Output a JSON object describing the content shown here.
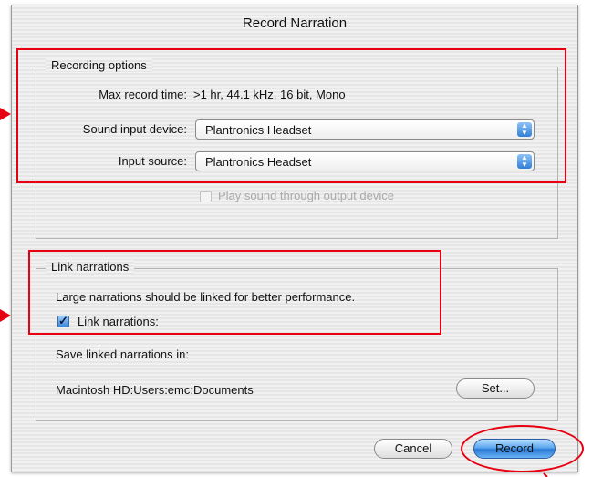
{
  "window": {
    "title": "Record Narration"
  },
  "recording_options": {
    "legend": "Recording options",
    "max_record_time_label": "Max record time:",
    "max_record_time_value": ">1 hr, 44.1 kHz, 16 bit, Mono",
    "sound_input_device_label": "Sound input device:",
    "sound_input_device_value": "Plantronics Headset",
    "input_source_label": "Input source:",
    "input_source_value": "Plantronics Headset",
    "play_through_label": "Play sound through output device",
    "play_through_checked": false,
    "play_through_enabled": false
  },
  "link_narrations": {
    "legend": "Link narrations",
    "description": "Large narrations should be linked for better performance.",
    "link_label": "Link narrations:",
    "link_checked": true,
    "save_in_label": "Save linked narrations in:",
    "save_path": "Macintosh HD:Users:emc:Documents",
    "set_button_label": "Set..."
  },
  "buttons": {
    "cancel_label": "Cancel",
    "record_label": "Record"
  },
  "icons": {
    "popup_arrows": "up-down-arrows-icon",
    "checkmark": "checkmark-icon"
  },
  "colors": {
    "annotation": "#e60012",
    "accent_blue": "#2a7ad6",
    "disabled_text": "#a9a9a9"
  }
}
